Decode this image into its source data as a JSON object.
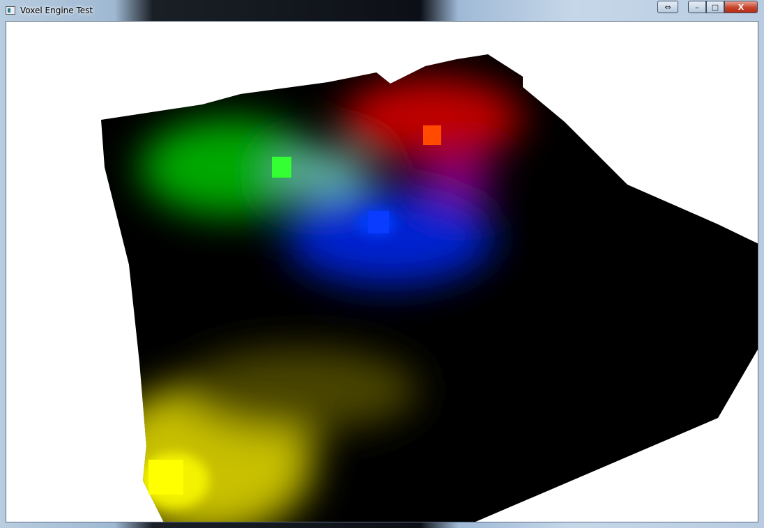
{
  "window": {
    "title": "Voxel Engine Test",
    "buttons": {
      "snap": "⇔",
      "minimize": "–",
      "maximize": "□",
      "close": "X"
    }
  },
  "scene": {
    "background": "#ffffff",
    "terrain_color": "#000000",
    "color_regions": [
      {
        "name": "green",
        "color": "#00c800"
      },
      {
        "name": "red",
        "color": "#e00000"
      },
      {
        "name": "blue",
        "color": "#0030ff"
      },
      {
        "name": "yellow",
        "color": "#ffff00"
      }
    ]
  }
}
